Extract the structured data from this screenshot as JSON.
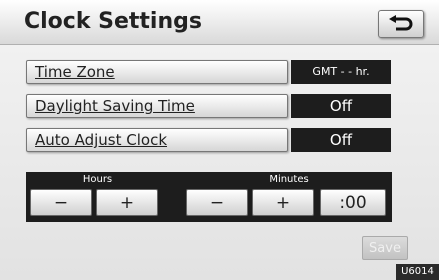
{
  "header": {
    "title": "Clock Settings",
    "back_icon": "return-arrow-icon"
  },
  "settings": [
    {
      "label": "Time Zone",
      "value": "GMT - - hr."
    },
    {
      "label": "Daylight Saving Time",
      "value": "Off"
    },
    {
      "label": "Auto Adjust Clock",
      "value": "Off"
    }
  ],
  "adjust": {
    "hours_label": "Hours",
    "minutes_label": "Minutes",
    "hours_minus": "−",
    "hours_plus": "+",
    "minutes_minus": "−",
    "minutes_plus": "+",
    "zero": ":00"
  },
  "footer": {
    "save_label": "Save",
    "image_code": "U6014"
  }
}
